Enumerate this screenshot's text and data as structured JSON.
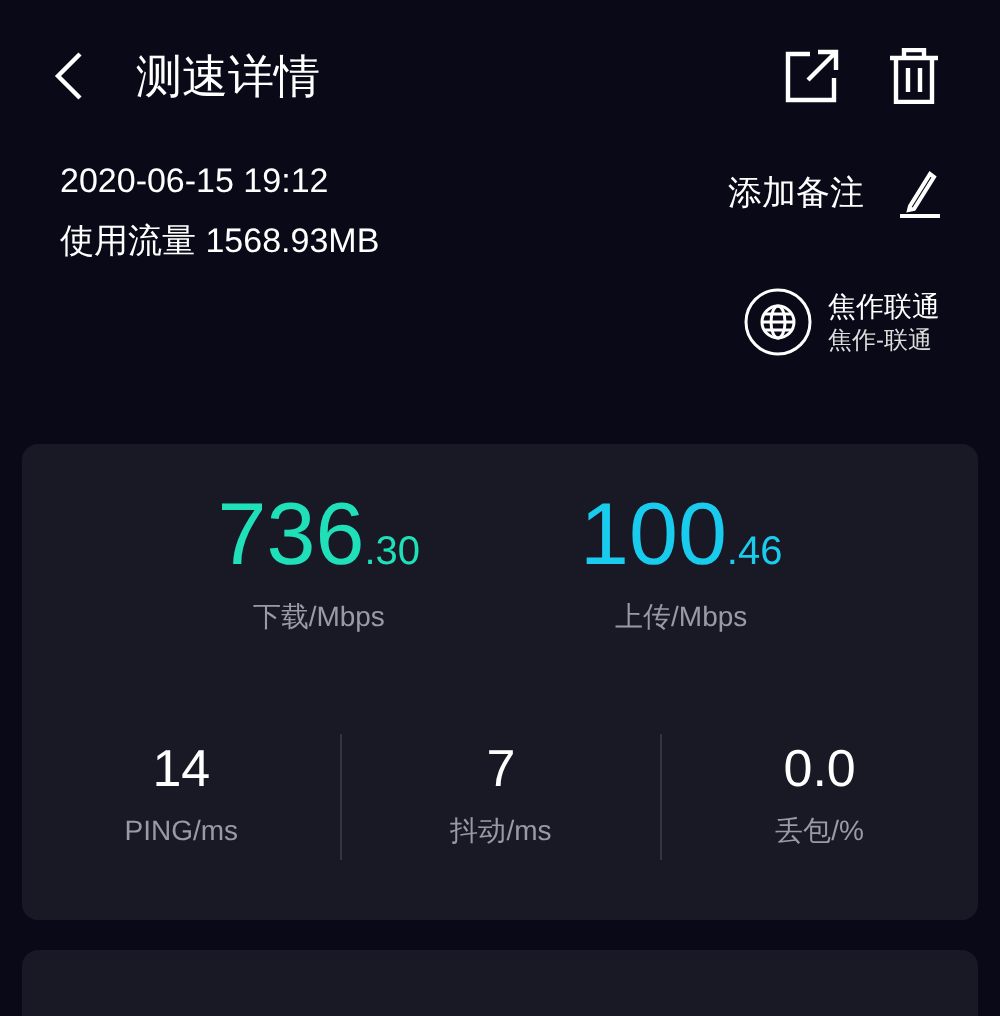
{
  "header": {
    "title": "测速详情"
  },
  "record": {
    "time": "2020-06-15 19:12",
    "usage": "使用流量 1568.93MB",
    "note_button": "添加备注"
  },
  "isp": {
    "name": "焦作联通",
    "detail": "焦作-联通"
  },
  "speeds": [
    {
      "integer": "736",
      "decimal": ".30",
      "label": "下载/Mbps",
      "color": "#1fe0b8"
    },
    {
      "integer": "100",
      "decimal": ".46",
      "label": "上传/Mbps",
      "color": "#19cbec"
    }
  ],
  "metrics": [
    {
      "value": "14",
      "label": "PING/ms"
    },
    {
      "value": "7",
      "label": "抖动/ms"
    },
    {
      "value": "0.0",
      "label": "丢包/%"
    }
  ]
}
